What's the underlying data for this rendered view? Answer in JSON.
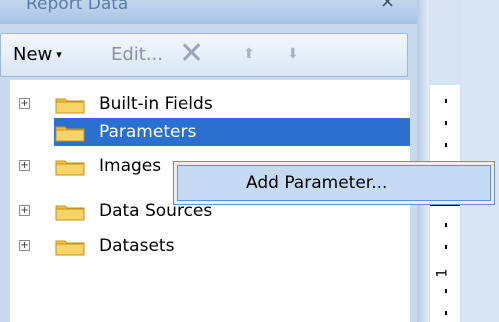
{
  "panel": {
    "title": "Report Data",
    "close": "×"
  },
  "toolbar": {
    "new_label": "New",
    "new_caret": "▾",
    "edit_label": "Edit...",
    "delete_glyph": "✕",
    "move_up_glyph": "⬆",
    "move_down_glyph": "⬇"
  },
  "tree": {
    "items": [
      {
        "label": "Built-in Fields",
        "expandable": true,
        "selected": false
      },
      {
        "label": "Parameters",
        "expandable": false,
        "selected": true
      },
      {
        "label": "Images",
        "expandable": true,
        "selected": false
      },
      {
        "label": "Data Sources",
        "expandable": true,
        "selected": false
      },
      {
        "label": "Datasets",
        "expandable": true,
        "selected": false
      }
    ],
    "expand_glyph": "+"
  },
  "context_menu": {
    "items": [
      {
        "label": "Add Parameter..."
      }
    ]
  },
  "ruler": {
    "marker": "1"
  },
  "colors": {
    "selection": "#2b6fcf",
    "folder": "#f2c23a",
    "menu_hover": "#c6daf5"
  }
}
